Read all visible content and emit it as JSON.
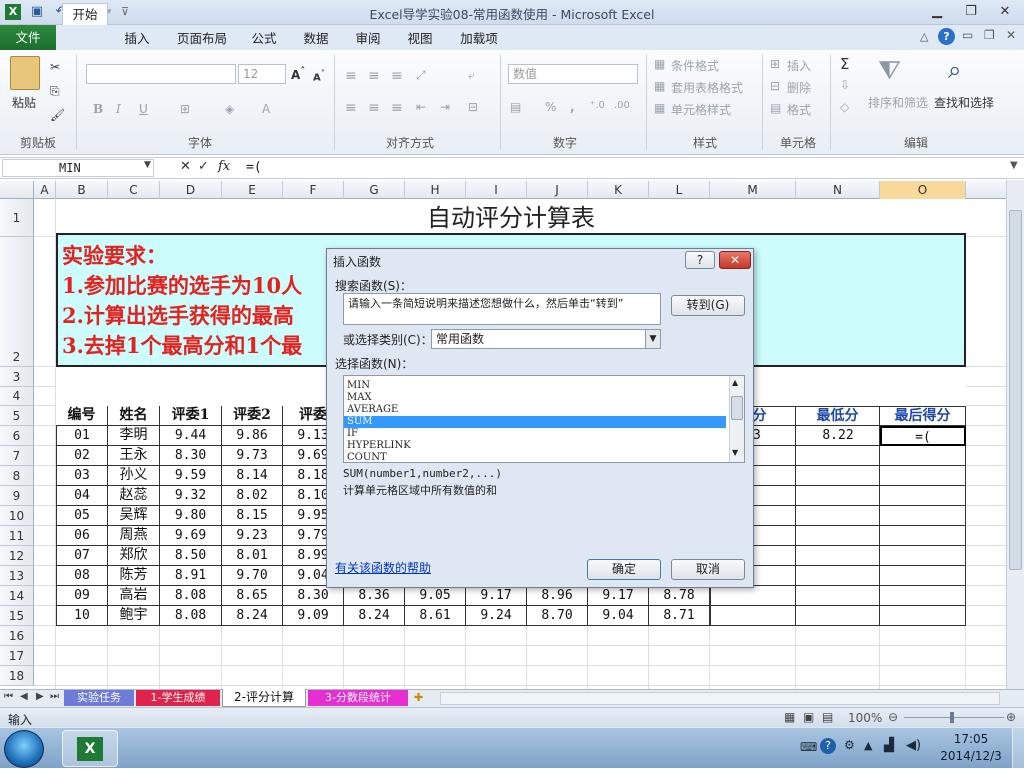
{
  "window": {
    "title": "Excel导学实验08-常用函数使用 - Microsoft Excel"
  },
  "tabs": [
    "文件",
    "开始",
    "插入",
    "页面布局",
    "公式",
    "数据",
    "审阅",
    "视图",
    "加载项"
  ],
  "ribbon": {
    "paste": "粘贴",
    "font_size": "12",
    "number_format": "数值",
    "conditional_format": "条件格式",
    "table_format": "套用表格格式",
    "cell_style": "单元格样式",
    "insert": "插入",
    "delete": "删除",
    "format": "格式",
    "sort_filter": "排序和筛选",
    "find_select": "查找和选择",
    "groups": [
      "剪贴板",
      "字体",
      "对齐方式",
      "数字",
      "样式",
      "单元格",
      "编辑"
    ]
  },
  "formula_bar": {
    "name_box": "MIN",
    "content": "=("
  },
  "columns": [
    "A",
    "B",
    "C",
    "D",
    "E",
    "F",
    "G",
    "H",
    "I",
    "J",
    "K",
    "L",
    "M",
    "N",
    "O"
  ],
  "rows": [
    "1",
    "2",
    "3",
    "4",
    "5",
    "6",
    "7",
    "8",
    "9",
    "10",
    "11",
    "12",
    "13",
    "14",
    "15",
    "16",
    "17",
    "18"
  ],
  "sheet": {
    "title": "自动评分计算表",
    "requirements": [
      "实验要求：",
      "1.参加比赛的选手为10人",
      "2.计算出选手获得的最高",
      "3.去掉1个最高分和1个最"
    ],
    "headers": [
      "编号",
      "姓名",
      "评委1",
      "评委2",
      "评委"
    ],
    "right_headers": [
      "高分",
      "最低分",
      "最后得分"
    ],
    "data": [
      [
        "01",
        "李明",
        "9.44",
        "9.86",
        "9.13"
      ],
      [
        "02",
        "王永",
        "8.30",
        "9.73",
        "9.69"
      ],
      [
        "03",
        "孙义",
        "9.59",
        "8.14",
        "8.18"
      ],
      [
        "04",
        "赵蕊",
        "9.32",
        "8.02",
        "8.10"
      ],
      [
        "05",
        "吴辉",
        "9.80",
        "8.15",
        "9.95"
      ],
      [
        "06",
        "周燕",
        "9.69",
        "9.23",
        "9.79"
      ],
      [
        "07",
        "郑欣",
        "8.50",
        "8.01",
        "8.99"
      ],
      [
        "08",
        "陈芳",
        "8.91",
        "9.70",
        "9.04"
      ],
      [
        "09",
        "高岩",
        "8.08",
        "8.65",
        "8.30",
        "8.36",
        "9.05",
        "9.17",
        "8.96",
        "9.17",
        "8.78"
      ],
      [
        "10",
        "鲍宇",
        "8.08",
        "8.24",
        "9.09",
        "8.24",
        "8.61",
        "9.24",
        "8.70",
        "9.04",
        "8.71"
      ]
    ],
    "row6_right": [
      "93",
      "8.22",
      "=("
    ]
  },
  "dialog": {
    "title": "插入函数",
    "help_btn": "?",
    "search_label": "搜索函数(S)：",
    "search_text": "请输入一条简短说明来描述您想做什么，然后单击“转到”",
    "go": "转到(G)",
    "category_label": "或选择类别(C)：",
    "category": "常用函数",
    "select_label": "选择函数(N)：",
    "functions": [
      "MIN",
      "MAX",
      "AVERAGE",
      "SUM",
      "IF",
      "HYPERLINK",
      "COUNT"
    ],
    "selected_index": 3,
    "signature": "SUM(number1,number2,...)",
    "description": "计算单元格区域中所有数值的和",
    "help_link": "有关该函数的帮助",
    "ok": "确定",
    "cancel": "取消"
  },
  "sheet_tabs": [
    "实验任务",
    "1-学生成绩",
    "2-评分计算",
    "3-分数段统计"
  ],
  "status": {
    "mode": "输入",
    "zoom": "100%"
  },
  "clock": {
    "time": "17:05",
    "date": "2014/12/3"
  },
  "colors": {
    "req_bg": "#ccfcfc",
    "req_text": "#e3211e",
    "header_blue": "#1f49a8",
    "select_blue": "#3399ff"
  }
}
